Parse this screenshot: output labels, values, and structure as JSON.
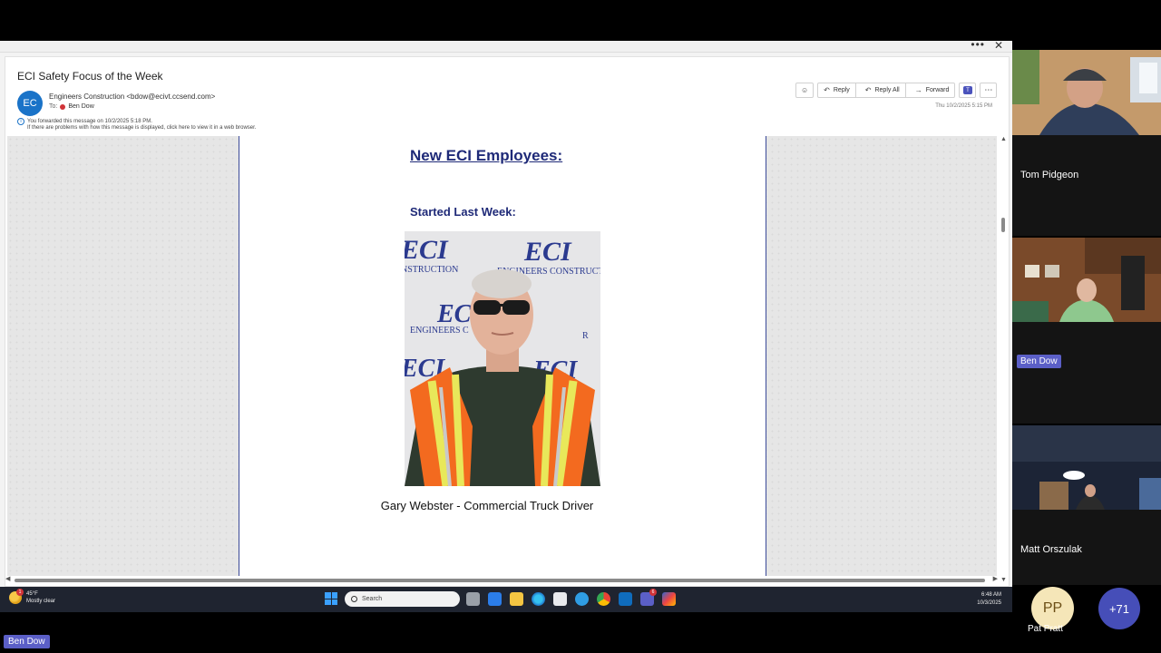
{
  "email": {
    "subject": "ECI Safety Focus of the Week",
    "avatar_initials": "EC",
    "sender": "Engineers Construction <bdow@ecivt.ccsend.com>",
    "to_label": "To:",
    "recipient": "Ben Dow",
    "forward_notice": "You forwarded this message on 10/2/2025 5:18 PM.",
    "display_notice": "If there are problems with how this message is displayed, click here to view it in a web browser.",
    "date": "Thu 10/2/2025 5:15 PM",
    "actions": {
      "reply": "Reply",
      "reply_all": "Reply All",
      "forward": "Forward"
    }
  },
  "newsletter": {
    "heading": "New ECI Employees:",
    "subheading": "Started Last Week:",
    "photo_logo_text": "ECI",
    "photo_company_text": "ENGINEERS CONSTRUCTION",
    "caption": "Gary Webster - Commercial Truck Driver"
  },
  "taskbar": {
    "weather_temp": "45°F",
    "weather_desc": "Mostly clear",
    "weather_badge": "1",
    "search_placeholder": "Search",
    "teams_badge": "6",
    "time": "6:48 AM",
    "date": "10/3/2025"
  },
  "participants": {
    "tiles": [
      "Tom Pidgeon",
      "Ben Dow",
      "Matt Orszulak"
    ],
    "pp_initials": "PP",
    "pp_name": "Pat Pratt",
    "more": "+71"
  },
  "presenter": "Ben Dow",
  "colors": {
    "heading": "#1f2a78",
    "teams_accent": "#5b5fc7",
    "avatar_blue": "#1a73c8"
  }
}
